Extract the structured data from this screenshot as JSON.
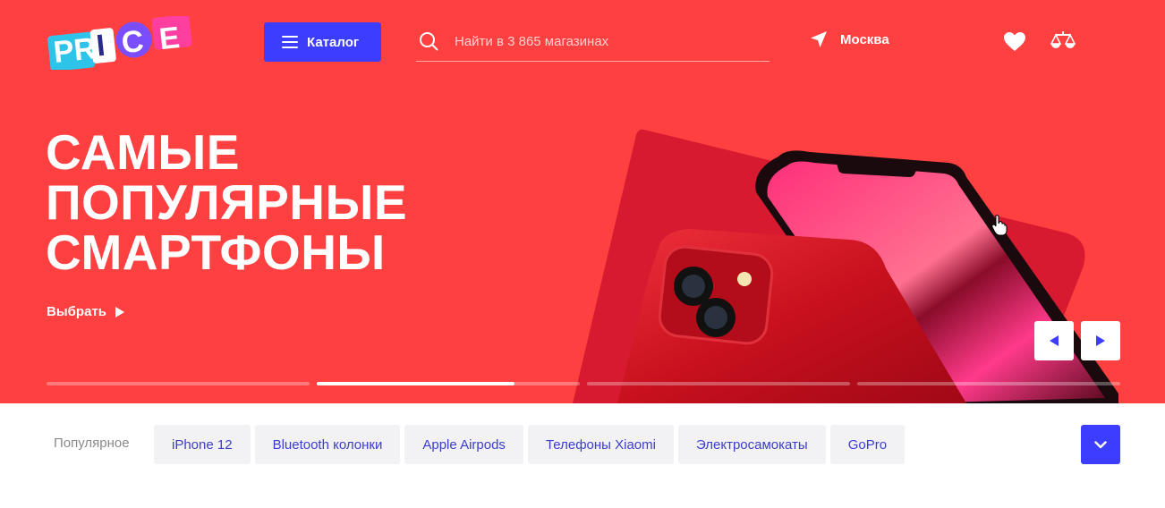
{
  "header": {
    "logo_text": "PRICE",
    "catalog_label": "Каталог",
    "search_placeholder": "Найти в 3 865 магазинах",
    "city": "Москва",
    "icons": [
      "search-icon",
      "location-arrow-icon",
      "heart-icon",
      "compare-scales-icon",
      "menu-icon"
    ]
  },
  "hero": {
    "headline": [
      "САМЫЕ",
      "ПОПУЛЯРНЫЕ",
      "СМАРТФОНЫ"
    ],
    "cta": "Выбрать",
    "slides_total": 4,
    "active_slide": 2,
    "active_slide_progress": 0.75
  },
  "popular": {
    "label": "Популярное",
    "chips": [
      "iPhone 12",
      "Bluetooth колонки",
      "Apple Airpods",
      "Телефоны Xiaomi",
      "Электросамокаты",
      "GoPro"
    ]
  },
  "colors": {
    "brand_red": "#ff4040",
    "accent_blue": "#3d3dff",
    "chip_text": "#3d3dcc",
    "chip_bg": "#f2f2f4"
  }
}
